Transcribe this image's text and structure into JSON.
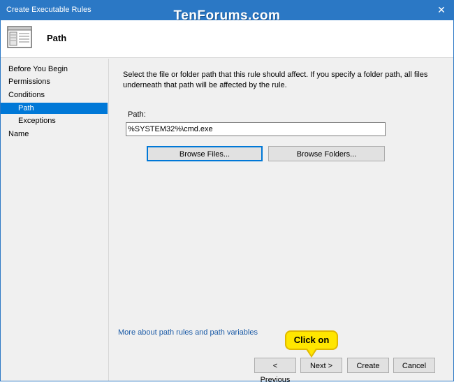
{
  "window": {
    "title": "Create Executable Rules",
    "close_glyph": "✕",
    "watermark": "TenForums.com"
  },
  "header": {
    "heading": "Path",
    "icon": "wizard-page-icon"
  },
  "sidebar": {
    "items": [
      {
        "label": "Before You Begin",
        "selected": false,
        "sub": false
      },
      {
        "label": "Permissions",
        "selected": false,
        "sub": false
      },
      {
        "label": "Conditions",
        "selected": false,
        "sub": false
      },
      {
        "label": "Path",
        "selected": true,
        "sub": true
      },
      {
        "label": "Exceptions",
        "selected": false,
        "sub": true
      },
      {
        "label": "Name",
        "selected": false,
        "sub": false
      }
    ]
  },
  "content": {
    "instruction": "Select the file or folder path that this rule should affect. If you specify a folder path, all files underneath that path will be affected by the rule.",
    "path_label": "Path:",
    "path_value": "%SYSTEM32%\\cmd.exe",
    "browse_files_label": "Browse Files...",
    "browse_folders_label": "Browse Folders...",
    "help_link": "More about path rules and path variables"
  },
  "footer": {
    "previous_label": "< Previous",
    "next_label": "Next >",
    "create_label": "Create",
    "cancel_label": "Cancel"
  },
  "callout": {
    "text": "Click on"
  },
  "colors": {
    "titlebar": "#2b78c5",
    "selection": "#0078d7",
    "link": "#1a5aa6",
    "callout": "#ffe600"
  }
}
